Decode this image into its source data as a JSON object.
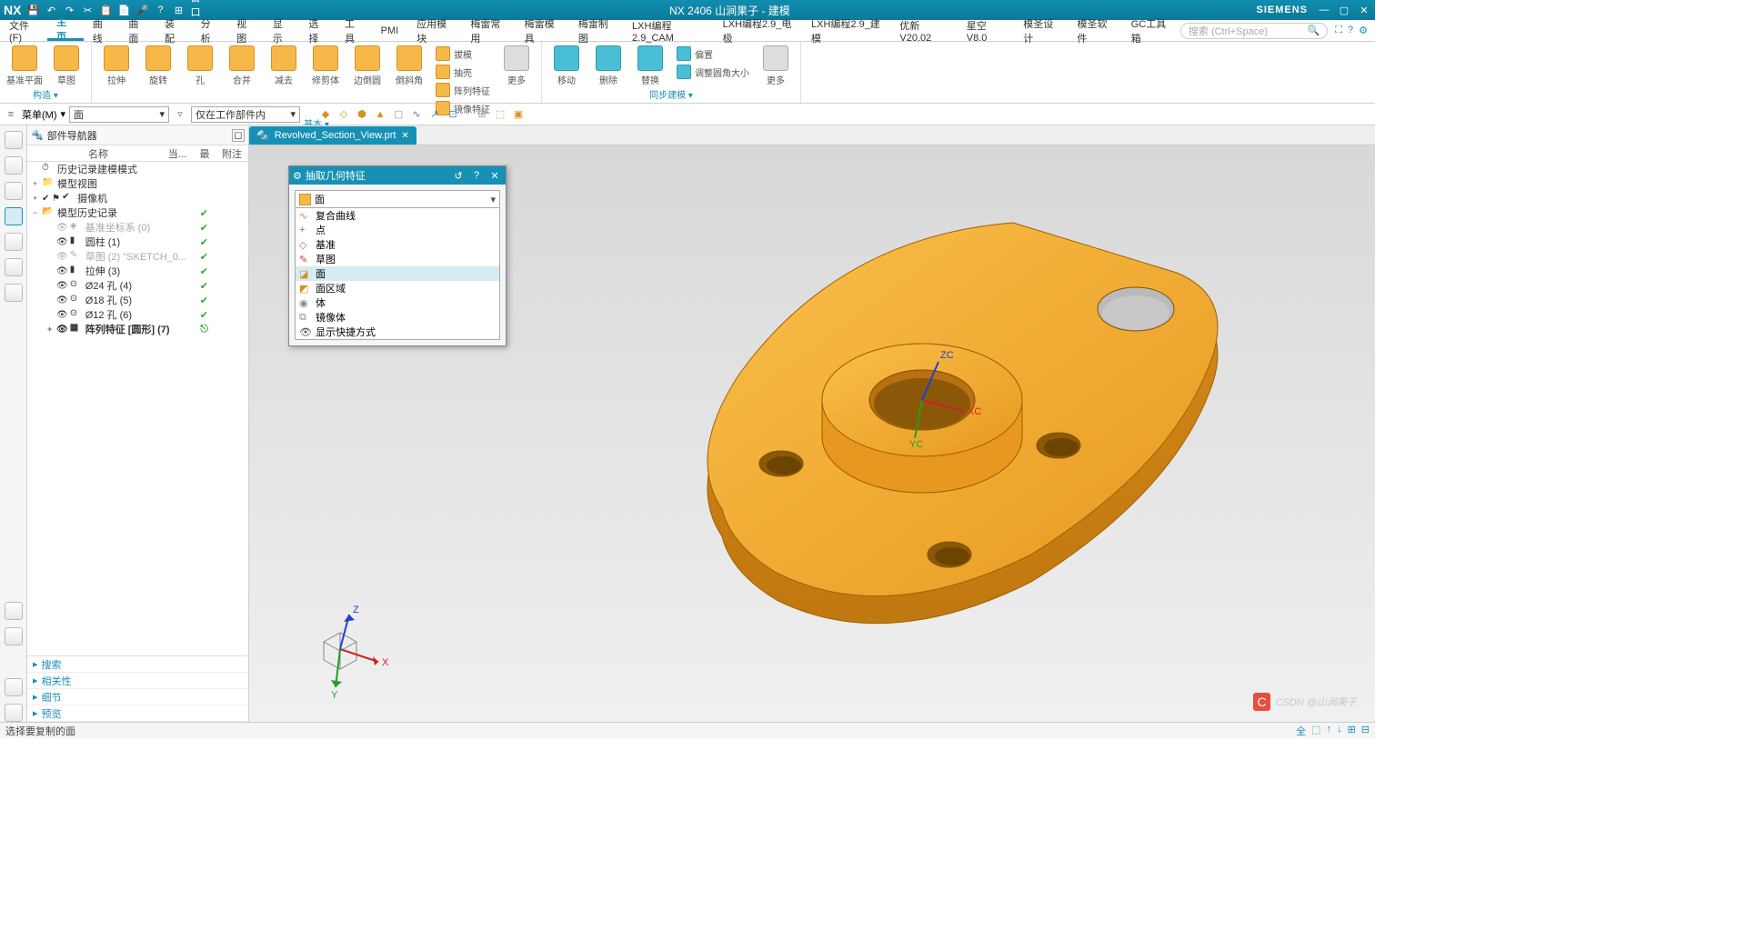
{
  "app": {
    "nx": "NX",
    "title": "NX 2406 山涧果子 - 建模",
    "brand": "SIEMENS"
  },
  "menu": {
    "items": [
      "文件(F)",
      "主页",
      "曲线",
      "曲面",
      "装配",
      "分析",
      "视图",
      "显示",
      "选择",
      "工具",
      "PMI",
      "应用模块",
      "梅雷常用",
      "梅雷模具",
      "梅雷制图",
      "LXH编程2.9_CAM",
      "LXH编程2.9_电极",
      "LXH编程2.9_建模",
      "优新 V20.02",
      "星空 V8.0",
      "模圣设计",
      "模圣软件",
      "GC工具箱"
    ],
    "active": 1,
    "search_ph": "搜索 (Ctrl+Space)"
  },
  "ribbon": {
    "groups": [
      {
        "label": "构造",
        "tools_lg": [
          {
            "l": "基准平面"
          },
          {
            "l": "草图"
          }
        ]
      },
      {
        "label": "基本",
        "tools_lg": [
          {
            "l": "拉伸"
          },
          {
            "l": "旋转"
          },
          {
            "l": "孔"
          },
          {
            "l": "合并"
          },
          {
            "l": "减去"
          },
          {
            "l": "修剪体"
          },
          {
            "l": "边倒圆"
          },
          {
            "l": "倒斜角"
          }
        ],
        "tools_sm": [
          {
            "l": "拔模"
          },
          {
            "l": "抽壳"
          },
          {
            "l": "阵列特征"
          },
          {
            "l": "镜像特征"
          }
        ],
        "more": "更多"
      },
      {
        "label": "同步建模",
        "tools_lg": [
          {
            "l": "移动"
          },
          {
            "l": "删除"
          },
          {
            "l": "替换"
          }
        ],
        "tools_sm": [
          {
            "l": "偏置"
          },
          {
            "l": "调整圆角大小"
          }
        ],
        "more": "更多"
      }
    ]
  },
  "selbar": {
    "menu": "菜单(M)",
    "combo1": "面",
    "combo2": "仅在工作部件内"
  },
  "nav": {
    "title": "部件导航器",
    "cols": [
      "名称",
      "当...",
      "最",
      "附注"
    ],
    "tree": [
      {
        "ind": 0,
        "exp": "",
        "icn": "⏱",
        "txt": "历史记录建模模式",
        "chk": ""
      },
      {
        "ind": 0,
        "exp": "+",
        "icn": "📁",
        "txt": "模型视图",
        "chk": ""
      },
      {
        "ind": 0,
        "exp": "+",
        "icn": "✔",
        "txt": "摄像机",
        "chk": "",
        "pre": "✔ ⚑"
      },
      {
        "ind": 0,
        "exp": "−",
        "icn": "📂",
        "txt": "模型历史记录",
        "chk": "✔"
      },
      {
        "ind": 1,
        "exp": "",
        "icn": "◈",
        "txt": "基准坐标系 (0)",
        "chk": "✔",
        "muted": true,
        "vis": "👁"
      },
      {
        "ind": 1,
        "exp": "",
        "icn": "▮",
        "txt": "圆柱 (1)",
        "chk": "✔",
        "vis": "👁"
      },
      {
        "ind": 1,
        "exp": "",
        "icn": "✎",
        "txt": "草图 (2) \"SKETCH_0...",
        "chk": "✔",
        "muted": true,
        "vis": "👁"
      },
      {
        "ind": 1,
        "exp": "",
        "icn": "▮",
        "txt": "拉伸 (3)",
        "chk": "✔",
        "vis": "👁"
      },
      {
        "ind": 1,
        "exp": "",
        "icn": "⊙",
        "txt": "Ø24 孔 (4)",
        "chk": "✔",
        "vis": "👁"
      },
      {
        "ind": 1,
        "exp": "",
        "icn": "⊙",
        "txt": "Ø18 孔 (5)",
        "chk": "✔",
        "vis": "👁"
      },
      {
        "ind": 1,
        "exp": "",
        "icn": "⊙",
        "txt": "Ø12 孔 (6)",
        "chk": "✔",
        "vis": "👁"
      },
      {
        "ind": 1,
        "exp": "+",
        "icn": "▦",
        "txt": "阵列特征 [圆形] (7)",
        "chk": "⎋",
        "bold": true,
        "vis": "👁"
      }
    ],
    "accordion": [
      "搜索",
      "相关性",
      "细节",
      "预览"
    ]
  },
  "tab": {
    "label": "Revolved_Section_View.prt"
  },
  "dialog": {
    "title": "抽取几何特征",
    "combo": "面",
    "options": [
      {
        "icn": "∿",
        "l": "复合曲线",
        "c": "#e08030"
      },
      {
        "icn": "+",
        "l": "点",
        "c": "#3a80d0"
      },
      {
        "icn": "◇",
        "l": "基准",
        "c": "#e05080"
      },
      {
        "icn": "✎",
        "l": "草图",
        "c": "#d04040"
      },
      {
        "icn": "◪",
        "l": "面",
        "c": "#d89020",
        "sel": true
      },
      {
        "icn": "◩",
        "l": "面区域",
        "c": "#d89020"
      },
      {
        "icn": "◉",
        "l": "体",
        "c": "#888"
      },
      {
        "icn": "⧉",
        "l": "镜像体",
        "c": "#888"
      },
      {
        "icn": "👁",
        "l": "显示快捷方式",
        "c": "#555"
      }
    ]
  },
  "status": {
    "msg": "选择要复制的面",
    "right": [
      "全",
      "⬚",
      "↑",
      "↓",
      "⊞",
      "⊟"
    ]
  },
  "triad": {
    "x": "X",
    "y": "Y",
    "z": "Z"
  },
  "wcs": {
    "x": "XC",
    "y": "YC",
    "z": "ZC"
  },
  "watermark": "CSDN @山涧果子"
}
